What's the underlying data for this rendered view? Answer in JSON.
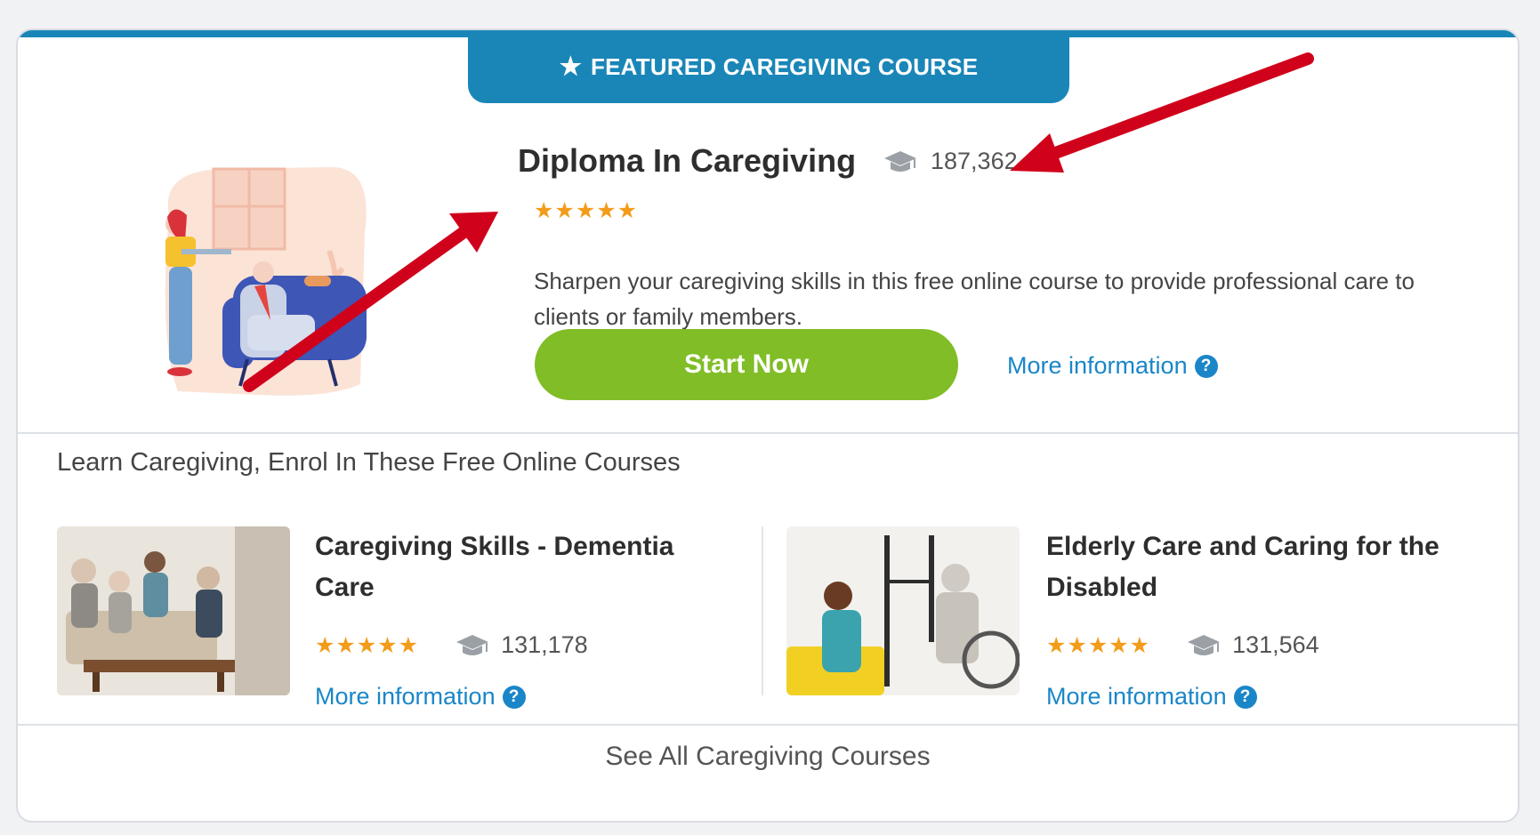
{
  "featured": {
    "tab_label": "FEATURED CAREGIVING COURSE",
    "title": "Diploma In Caregiving",
    "enrolled": "187,362",
    "rating_stars": 5,
    "description": "Sharpen your caregiving skills in this free online course to provide professional care to clients or family members.",
    "start_label": "Start Now",
    "more_info_label": "More information"
  },
  "section": {
    "heading": "Learn Caregiving, Enrol In These Free Online Courses"
  },
  "courses": [
    {
      "title": "Caregiving Skills - Dementia Care",
      "enrolled": "131,178",
      "rating_stars": 5,
      "more_info_label": "More information"
    },
    {
      "title": "Elderly Care and Caring for the Disabled",
      "enrolled": "131,564",
      "rating_stars": 5,
      "more_info_label": "More information"
    }
  ],
  "footer": {
    "see_all_label": "See All Caregiving Courses"
  },
  "icons": [
    "star-icon",
    "graduation-cap-icon",
    "help-circle-icon"
  ],
  "colors": {
    "brand_blue": "#1a86b8",
    "button_green": "#80bd26",
    "star_orange": "#f39c1a",
    "link_blue": "#1a86c8",
    "annotation_red": "#d0021b"
  }
}
